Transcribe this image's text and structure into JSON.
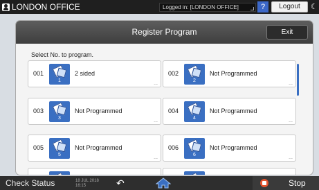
{
  "topbar": {
    "user_label": "LONDON OFFICE",
    "logged_in": "Logged in: [LONDON OFFICE]",
    "help_label": "?",
    "logout_label": "Logout"
  },
  "dialog": {
    "title": "Register Program",
    "exit_label": "Exit",
    "instruction": "Select No. to program.",
    "more_label": "...",
    "programs": [
      {
        "num": "001",
        "icon_index": "1",
        "label": "2 sided"
      },
      {
        "num": "002",
        "icon_index": "2",
        "label": "Not Programmed"
      },
      {
        "num": "003",
        "icon_index": "3",
        "label": "Not Programmed"
      },
      {
        "num": "004",
        "icon_index": "4",
        "label": "Not Programmed"
      },
      {
        "num": "005",
        "icon_index": "5",
        "label": "Not Programmed"
      },
      {
        "num": "006",
        "icon_index": "6",
        "label": "Not Programmed"
      }
    ]
  },
  "bottombar": {
    "check_status_label": "Check Status",
    "date": "18 JUL 2018",
    "time": "16:15",
    "stop_label": "Stop"
  },
  "colors": {
    "accent": "#3a6fc2",
    "stop": "#e5532d",
    "header": "#4a4a4a"
  }
}
